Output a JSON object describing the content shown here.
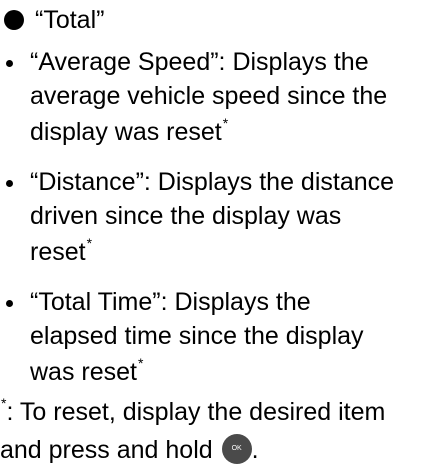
{
  "heading": "“Total”",
  "items": [
    {
      "lines": [
        "“Average Speed”: Displays the",
        "average vehicle speed since the",
        "display was reset"
      ],
      "star": "*"
    },
    {
      "lines": [
        "“Distance”: Displays the distance",
        "driven since the display was",
        "reset"
      ],
      "star": "*"
    },
    {
      "lines": [
        "“Total Time”: Displays the",
        "elapsed time since the display",
        "was reset"
      ],
      "star": "*"
    }
  ],
  "note": {
    "star": "*",
    "line1": ": To reset, display the desired item",
    "line2": "and press and hold",
    "button_label": "OK",
    "end": "."
  }
}
